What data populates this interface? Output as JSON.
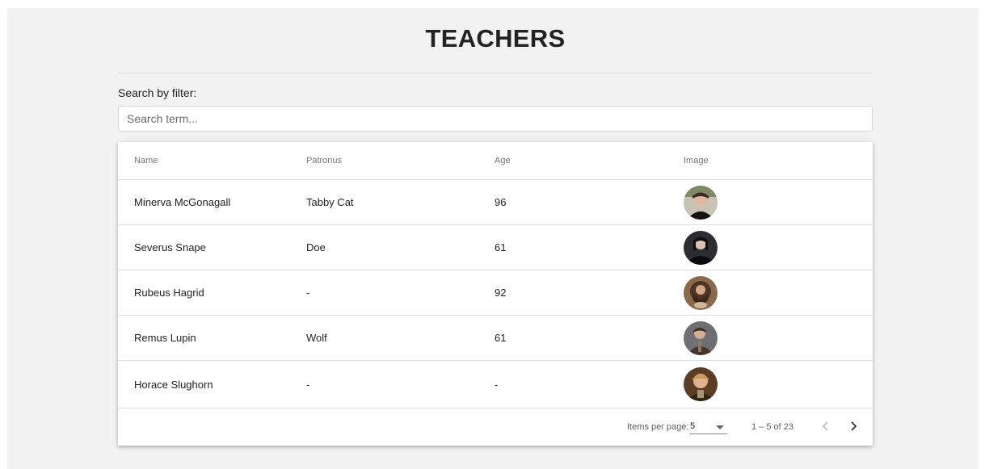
{
  "page": {
    "title": "TEACHERS"
  },
  "filter": {
    "label": "Search by filter:",
    "placeholder": "Search term...",
    "value": ""
  },
  "table": {
    "columns": {
      "name": "Name",
      "patronus": "Patronus",
      "age": "Age",
      "image": "Image"
    },
    "rows": [
      {
        "name": "Minerva McGonagall",
        "patronus": "Tabby Cat",
        "age": "96",
        "avatar_color": "#3b2a24"
      },
      {
        "name": "Severus Snape",
        "patronus": "Doe",
        "age": "61",
        "avatar_color": "#1a1a1e"
      },
      {
        "name": "Rubeus Hagrid",
        "patronus": "-",
        "age": "92",
        "avatar_color": "#6b4a2c"
      },
      {
        "name": "Remus Lupin",
        "patronus": "Wolf",
        "age": "61",
        "avatar_color": "#4a3a30"
      },
      {
        "name": "Horace Slughorn",
        "patronus": "-",
        "age": "-",
        "avatar_color": "#7a5430"
      }
    ]
  },
  "paginator": {
    "items_label": "Items per page:",
    "page_size": "5",
    "range": "1 – 5 of 23",
    "prev_icon": "chevron-left-icon",
    "next_icon": "chevron-right-icon",
    "prev_color": "#bdbdbd",
    "next_color": "#333333"
  }
}
